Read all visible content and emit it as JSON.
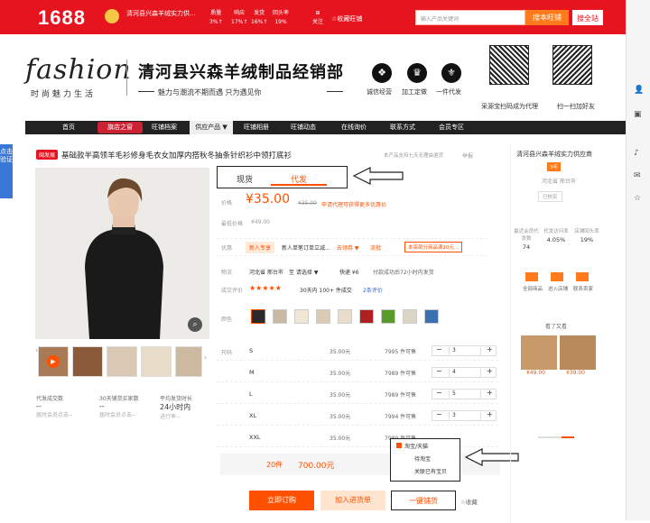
{
  "topbar": {
    "logo": "1688",
    "shop_name": "清河县兴森羊绒实力供...",
    "stats": [
      {
        "label": "质量",
        "value": "3%↑"
      },
      {
        "label": "响应",
        "value": "17%↑"
      },
      {
        "label": "发货",
        "value": "16%↑"
      },
      {
        "label": "回头率",
        "value": "19%"
      }
    ],
    "follow_label": "关注",
    "fav_label": "☆收藏旺铺",
    "search_placeholder": "输入产品关键词",
    "search_btn": "搜本旺铺",
    "search_all_btn": "搜全站"
  },
  "header": {
    "fashion": "fashion",
    "fashion_sub": "时尚魅力生活",
    "brand_title": "清河县兴森羊绒制品经销部",
    "slogan": "魅力与潮流不期而遇 只为遇见你",
    "badges": [
      "诚信经营",
      "加工定做",
      "一件代发"
    ],
    "qr_captions": [
      "采源宝扫码成为代理",
      "扫一扫加好友"
    ]
  },
  "nav": [
    "首页",
    "旗店之窗",
    "旺铺档案",
    "供应产品 ▼",
    "旺铺相册",
    "旺铺动态",
    "在线询价",
    "联系方式",
    "会员专区"
  ],
  "left_strip": "点击验证",
  "product": {
    "tag": "闽发展",
    "title": "基础款半高领羊毛衫修身毛衣女加厚内搭秋冬抽条针织衫中领打底衫",
    "report": "举报",
    "support_note": "本产品支持七天无理由退货",
    "thumbs_count": 5,
    "metrics": [
      {
        "label": "代发成交数",
        "value": "--",
        "sub": "届时会员点击--"
      },
      {
        "label": "30天铺货买家数",
        "value": "--",
        "sub": "届时会员点击--"
      },
      {
        "label": "平均发货时长",
        "value": "24小时内",
        "sub": "进行率--"
      }
    ]
  },
  "tabs": {
    "left": "现货",
    "right": "代发"
  },
  "price": {
    "label": "价格",
    "value": "¥35.00",
    "original": "¥35.00",
    "note": "申请代理可获得更多优惠价",
    "min_label": "最低价格",
    "min_value": "¥49.00"
  },
  "promo": {
    "label": "优惠",
    "new_user": "新人专享",
    "coupon": "新人单笔订单立减...",
    "coupon_link": "去领券 ▼",
    "flow": "流批",
    "flow_text": "本店部分商品满10元..."
  },
  "shipping": {
    "label": "物流",
    "from": "河北省 邢台市",
    "to": "至 请选择 ▼",
    "express": "快递 ¥6",
    "note": "付款成功后72小时内发货"
  },
  "review": {
    "label": "成交评价",
    "stars": "★★★★★",
    "sold": "30天内 100+ 件成交",
    "count": "2条评价"
  },
  "colors": {
    "label": "颜色",
    "swatches": [
      "#2a2a2a",
      "#c8b8a4",
      "#efe6d5",
      "#d9cbb6",
      "#e8dccb",
      "#b02020",
      "#5a9a2a",
      "#dcd4c6",
      "#3a6fb0"
    ]
  },
  "sizes": {
    "label": "尺码",
    "rows": [
      {
        "size": "S",
        "price": "35.00元",
        "stock": "7995 件可售",
        "qty": "3"
      },
      {
        "size": "M",
        "price": "35.00元",
        "stock": "7989 件可售",
        "qty": "4"
      },
      {
        "size": "L",
        "price": "35.00元",
        "stock": "7989 件可售",
        "qty": "5"
      },
      {
        "size": "XL",
        "price": "35.00元",
        "stock": "7994 件可售",
        "qty": "3"
      },
      {
        "size": "XXL",
        "price": "35.00元",
        "stock": "7989 件可售",
        "qty": ""
      }
    ]
  },
  "summary": {
    "count": "20件",
    "total": "700.00元"
  },
  "actions": {
    "order": "立即订购",
    "cart": "加入进货单",
    "onekey": "一键铺货",
    "fav": "☆收藏"
  },
  "popup": [
    "淘宝/天猫",
    "待淘宝",
    "关联已有宝贝"
  ],
  "sidebar": {
    "shop_name": "清河县兴森羊绒实力供应商",
    "years": "3年",
    "location": "河北省 邢台市",
    "verified": "已核实",
    "stats": [
      {
        "label": "最近会员代发数",
        "value": "74"
      },
      {
        "label": "代发访问率",
        "value": "4.05%"
      },
      {
        "label": "店铺回头率",
        "value": "19%"
      }
    ],
    "links": [
      "全部商品",
      "进入店铺",
      "联系卖家"
    ],
    "seen_title": "看了又看",
    "seen_prices": [
      "¥49.00",
      "¥39.00"
    ]
  }
}
